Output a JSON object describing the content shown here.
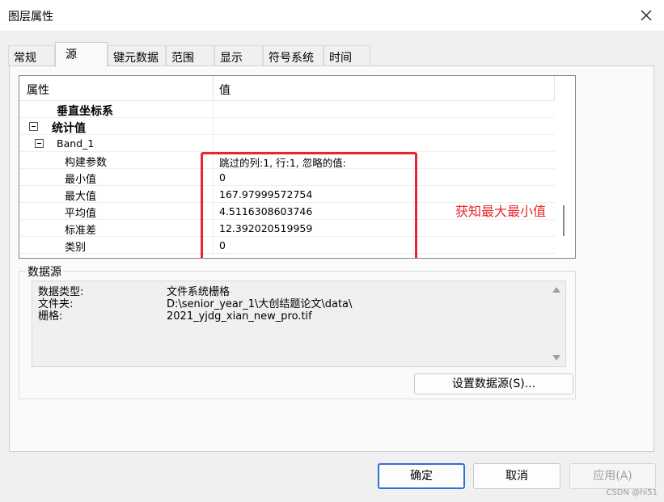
{
  "window": {
    "title": "图层属性"
  },
  "tabs": [
    {
      "label": "常规",
      "active": false
    },
    {
      "label": "源",
      "active": true
    },
    {
      "label": "键元数据",
      "active": false
    },
    {
      "label": "范围",
      "active": false
    },
    {
      "label": "显示",
      "active": false
    },
    {
      "label": "符号系统",
      "active": false
    },
    {
      "label": "时间",
      "active": false
    }
  ],
  "property_grid": {
    "col_property": "属性",
    "col_value": "值",
    "rows": [
      {
        "name": "垂直坐标系",
        "value": ""
      },
      {
        "name": "统计值",
        "value": ""
      },
      {
        "name": "Band_1",
        "value": ""
      },
      {
        "name": "构建参数",
        "value": "跳过的列:1, 行:1, 忽略的值:"
      },
      {
        "name": "最小值",
        "value": "0"
      },
      {
        "name": "最大值",
        "value": "167.97999572754"
      },
      {
        "name": "平均值",
        "value": "4.5116308603746"
      },
      {
        "name": "标准差",
        "value": "12.392020519959"
      },
      {
        "name": "类别",
        "value": "0"
      }
    ]
  },
  "annotation": {
    "text": "获知最大最小值",
    "color": "#e8262d"
  },
  "datasource": {
    "legend": "数据源",
    "rows": [
      {
        "key": "数据类型:",
        "value": "文件系统栅格"
      },
      {
        "key": "文件夹:",
        "value": "D:\\senior_year_1\\大创结题论文\\data\\"
      },
      {
        "key": "栅格:",
        "value": "2021_yjdg_xian_new_pro.tif"
      }
    ],
    "set_button": "设置数据源(S)..."
  },
  "footer": {
    "ok": "确定",
    "cancel": "取消",
    "apply": "应用(A)"
  },
  "watermark": "CSDN @hi51"
}
